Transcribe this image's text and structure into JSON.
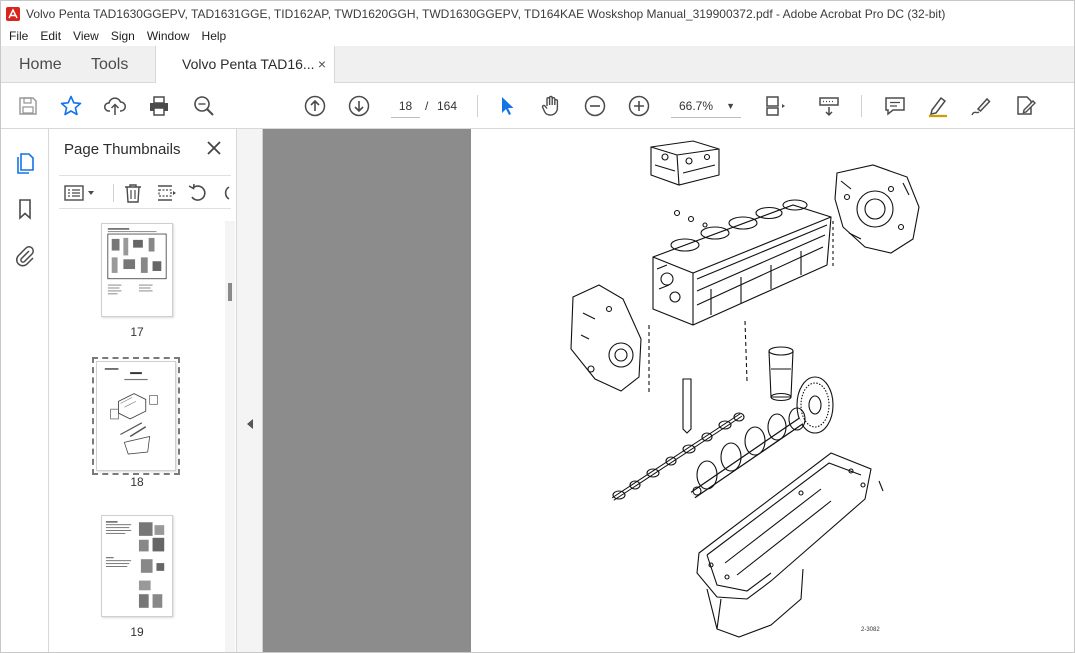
{
  "window": {
    "title": "Volvo Penta TAD1630GGEPV, TAD1631GGE,  TID162AP, TWD1620GGH, TWD1630GGEPV, TD164KAE Woskshop Manual_319900372.pdf - Adobe Acrobat Pro DC (32-bit)"
  },
  "menu": [
    "File",
    "Edit",
    "View",
    "Sign",
    "Window",
    "Help"
  ],
  "tabs": {
    "home": "Home",
    "tools": "Tools",
    "document": "Volvo Penta TAD16...",
    "close": "×"
  },
  "toolbar": {
    "page_current": "18",
    "page_separator": "/",
    "page_total": "164",
    "zoom": "66.7%",
    "icons": [
      "save-icon",
      "star-icon",
      "upload-icon",
      "print-icon",
      "zoom-search-icon",
      "page-up-icon",
      "page-down-icon",
      "select-arrow-icon",
      "hand-icon",
      "zoom-out-icon",
      "zoom-in-icon",
      "page-fit-icon",
      "scroll-mode-icon",
      "comment-icon",
      "highlight-icon",
      "draw-icon",
      "fill-sign-icon"
    ]
  },
  "thumbnails": {
    "title": "Page Thumbnails",
    "pages": [
      {
        "label": "17",
        "selected": false
      },
      {
        "label": "18",
        "selected": true
      },
      {
        "label": "19",
        "selected": false
      }
    ]
  },
  "document": {
    "figure_code": "2-3082"
  },
  "colors": {
    "accent": "#1473e6",
    "doc_background": "#8c8c8c",
    "acrobat_red": "#d7261e"
  }
}
